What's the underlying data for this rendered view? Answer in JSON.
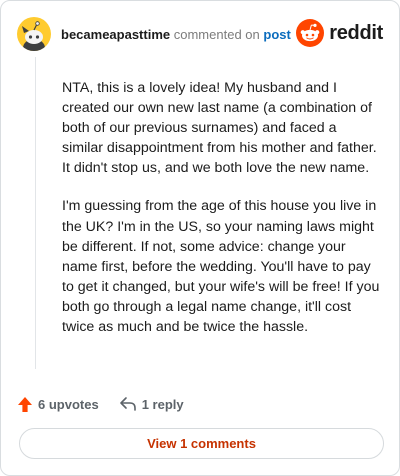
{
  "header": {
    "username": "becameapasttime",
    "action": "commented on",
    "post_link": "post",
    "brand": "reddit"
  },
  "comment": {
    "paragraphs": [
      "NTA, this is a lovely idea! My husband and I created our own new last name (a combination of both of our previous surnames) and faced a similar disappointment from his mother and father. It didn't stop us, and we both love the new name.",
      "I'm guessing from the age of this house you live in the UK? I'm in the US, so your naming laws might be different. If not, some advice: change your name first, before the wedding. You'll have to pay to get it changed, but your wife's will be free! If you both go through a legal name change, it'll cost twice as much and be twice the hassle."
    ]
  },
  "footer": {
    "upvotes": "6 upvotes",
    "reply": "1 reply"
  },
  "view_button": "View 1 comments",
  "colors": {
    "upvote": "#ff4500",
    "reddit_orange": "#ff4500",
    "link_blue": "#0b6cbd",
    "button_text": "#c63200"
  }
}
